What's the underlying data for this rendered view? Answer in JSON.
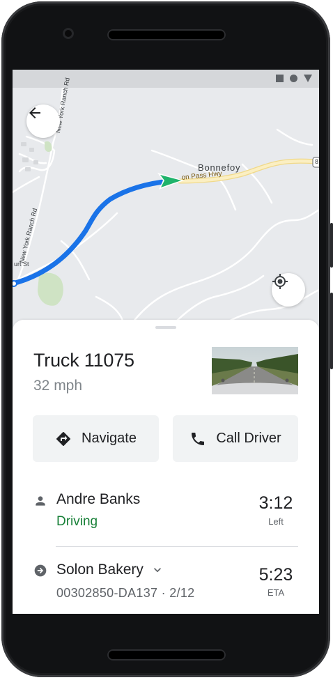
{
  "map": {
    "road_labels": {
      "new_york_ranch_top": "New York Ranch Rd",
      "new_york_ranch_left": "New York Ranch Rd",
      "court_st": "urt St",
      "pass_hwy": "on Pass Hwy",
      "route_badge": "8"
    },
    "place_label": "Bonnefoy",
    "colors": {
      "route": "#1a73e8",
      "vehicle": "#1fb36b",
      "highway": "#f5e6a8"
    }
  },
  "sheet": {
    "vehicle_name": "Truck 11075",
    "speed": "32 mph",
    "buttons": {
      "navigate": "Navigate",
      "call_driver": "Call Driver"
    },
    "driver": {
      "name": "Andre Banks",
      "status": "Driving",
      "time": "3:12",
      "time_label": "Left"
    },
    "destination": {
      "name": "Solon Bakery",
      "order": "00302850-DA137 · 2/12",
      "time": "5:23",
      "time_label": "ETA"
    }
  },
  "icons": {
    "back": "arrow-left-icon",
    "locate": "my-location-icon",
    "navigate": "directions-icon",
    "call": "phone-icon",
    "person": "person-icon",
    "destination": "arrow-circle-icon",
    "expand": "chevron-down-icon"
  }
}
